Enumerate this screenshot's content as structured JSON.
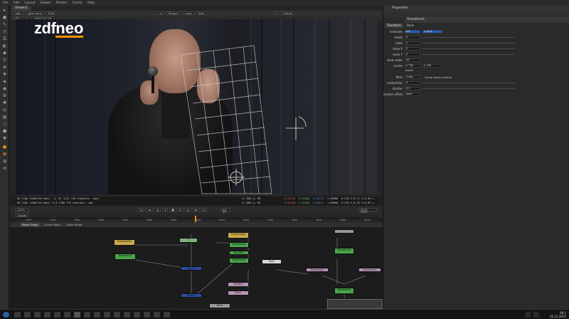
{
  "menu": [
    "File",
    "Edit",
    "Layout",
    "Viewer",
    "Render",
    "Cache",
    "Help"
  ],
  "viewer": {
    "tab": "Viewer1",
    "toolbar1": [
      "rgba",
      "rgba.alpha",
      "RGB",
      "A",
      "Merge2",
      "none",
      "Dot1",
      "1",
      "default"
    ],
    "toolbar2": [
      "f/8",
      "1",
      "1280x720 HD"
    ],
    "logo_zdf": "zdf",
    "logo_neo": "neo",
    "info1_left": "HD_720p 1280x720 bbox: -4 -87 1312 720 channels: rgba",
    "info1_mid": "x= 880 y= 98",
    "info1_vals": [
      "0.01770",
      "0.02006",
      "0.04771",
      "1.00000"
    ],
    "info1_right": "H:220 S:0.27 V:0.05 L: 0.02331",
    "info2_left": "HD_720p 1280x720 bbox: 0 0 1280 720 channels: rgb",
    "info2_mid": "x= 880 y= 98",
    "info2_vals": [
      "0.02290",
      "0.02566",
      "0.04511",
      "1.00000"
    ],
    "info2_right": "H:220 S:0.25 V:0.05 L: 0.04940"
  },
  "timeline": {
    "frame": "2972",
    "fps": "fps 25",
    "range_start": "2950",
    "range_end": "2944-3010",
    "global": "Global",
    "ticks": [
      "2930",
      "2940",
      "2950",
      "2960",
      "2970",
      "2980",
      "2990",
      "3000",
      "3010",
      "3020",
      "3030",
      "3040",
      "3050",
      "3060",
      "3070"
    ]
  },
  "nodegraph": {
    "tabs": [
      "Node Graph",
      "Curve Editor",
      "Dope Sheet"
    ],
    "nodes": [
      {
        "label": "FrameHold1",
        "color": "gold"
      },
      {
        "label": "RotoPaint1",
        "color": "green"
      },
      {
        "label": "FrameHold2",
        "color": "gold"
      },
      {
        "label": "RotoPaint2",
        "color": "green"
      },
      {
        "label": "Shuffle1",
        "color": "green"
      },
      {
        "label": "RotoPaint3",
        "color": "green"
      },
      {
        "label": "Merge1",
        "color": "blue"
      },
      {
        "label": "Merge2",
        "color": "blue"
      },
      {
        "label": "Grade1",
        "color": "pink"
      },
      {
        "label": "Blur1",
        "color": "pink"
      },
      {
        "label": "Dot1",
        "color": "white"
      },
      {
        "label": "RotoPaint4",
        "color": "green"
      },
      {
        "label": "RotoPaint5",
        "color": "green"
      },
      {
        "label": "Transform1",
        "color": "pink"
      },
      {
        "label": "Transform2",
        "color": "pink"
      },
      {
        "label": "Text1",
        "color": "grey"
      }
    ]
  },
  "properties": {
    "title": "Properties",
    "node_name": "Transform1",
    "tabs": [
      "Transform",
      "Node"
    ],
    "rows": [
      {
        "label": "translate",
        "value": "x 0",
        "value2": "y 11.0",
        "highlight": true
      },
      {
        "label": "rotate",
        "value": "0"
      },
      {
        "label": "scale",
        "value": "1"
      },
      {
        "label": "skew X",
        "value": "0"
      },
      {
        "label": "skew Y",
        "value": "0"
      },
      {
        "label": "skew order",
        "value": "XY"
      },
      {
        "label": "center",
        "value": "x 760",
        "value2": "y 190"
      },
      {
        "label": "",
        "value": "invert"
      },
      {
        "label": "filter",
        "value": "Cubic",
        "extra": "clamp  black outside"
      },
      {
        "label": "motionblur",
        "value": "0"
      },
      {
        "label": "shutter",
        "value": "0.5"
      },
      {
        "label": "shutter offset",
        "value": "start"
      }
    ]
  },
  "taskbar": {
    "time": "08:2",
    "date": "21.11.2015"
  },
  "colors": {
    "accent": "#f29400",
    "highlight": "#1f5fbf",
    "node_green": "#4aa44a",
    "node_gold": "#c9a94d",
    "node_blue": "#2b4fa8"
  }
}
